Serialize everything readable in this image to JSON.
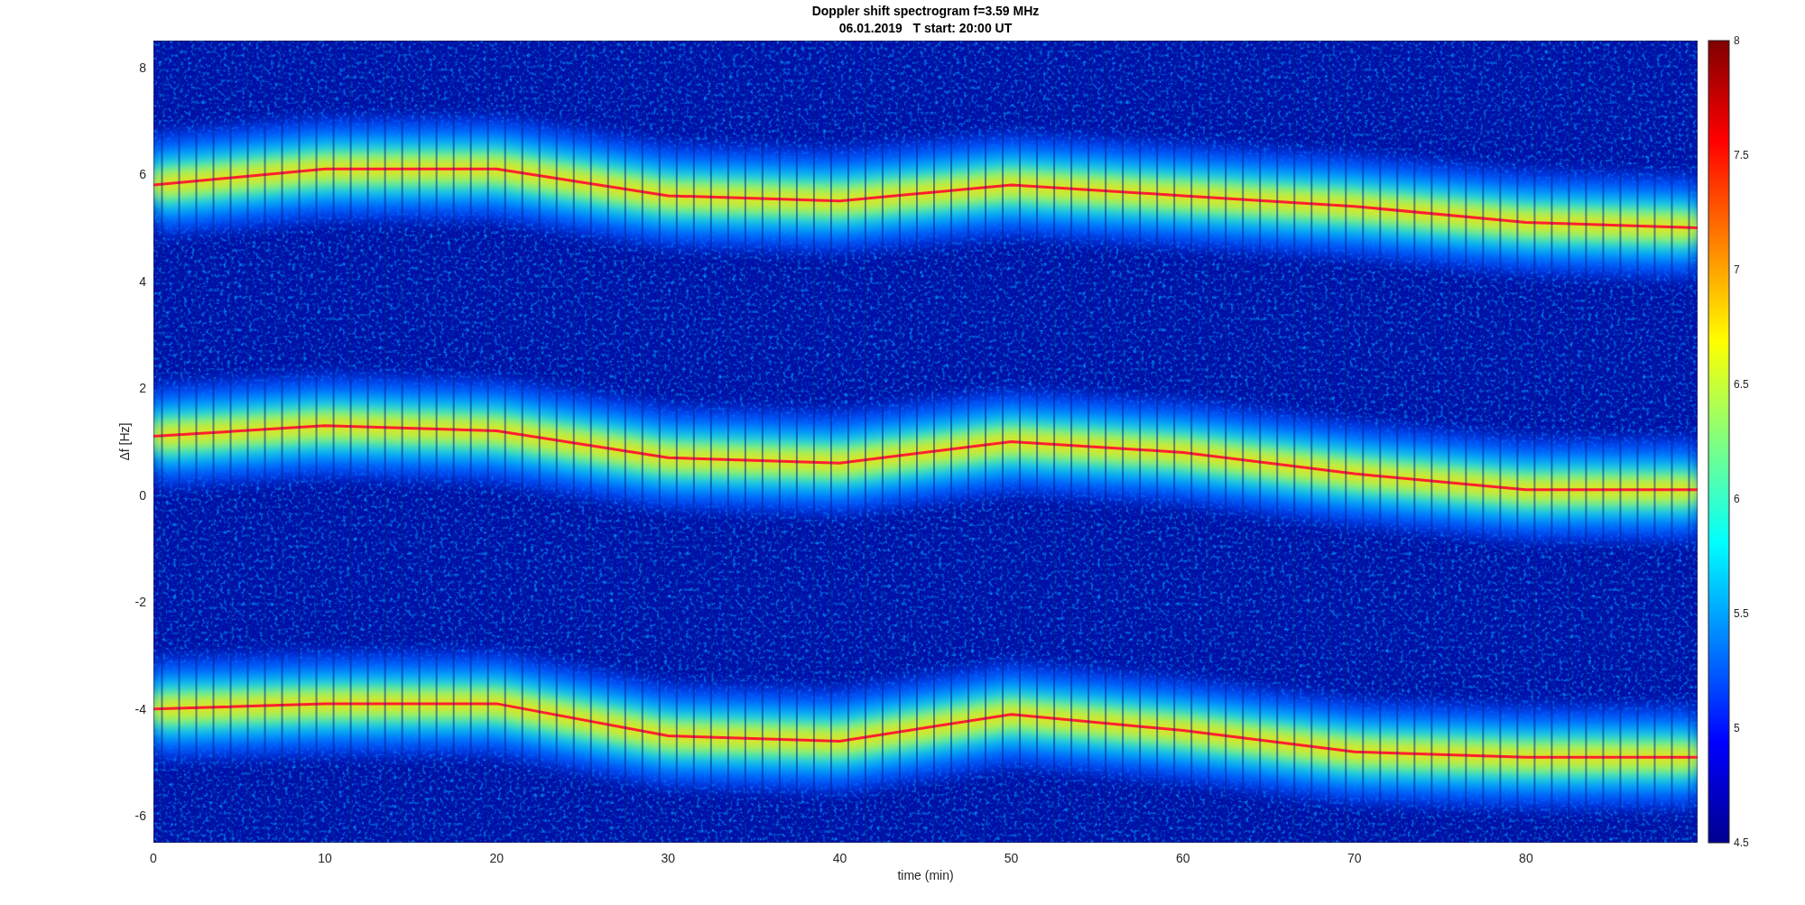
{
  "figure": {
    "title_lines": [
      "Doppler shift spectrogram f=3.59 MHz",
      "06.01.2019   T start: 20:00 UT"
    ],
    "xlabel": "time (min)",
    "ylabel": "Δf [Hz]",
    "xticks": [
      "0",
      "10",
      "20",
      "30",
      "40",
      "50",
      "60",
      "70",
      "80"
    ],
    "yticks": [
      "8",
      "6",
      "4",
      "2",
      "0",
      "-2",
      "-4",
      "-6"
    ],
    "colorbar": {
      "ticks": [
        "8",
        "7.5",
        "7",
        "6.5",
        "6",
        "5.5",
        "5",
        "4.5"
      ]
    }
  }
}
